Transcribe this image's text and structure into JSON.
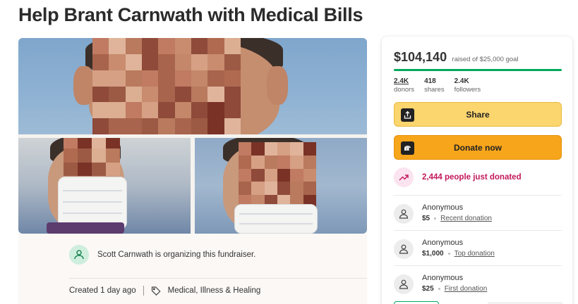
{
  "campaign": {
    "title": "Help Brant Carnwath with Medical Bills",
    "organizer_text": "Scott Carnwath is organizing this fundraiser.",
    "created": "Created 1 day ago",
    "category": "Medical, Illness & Healing"
  },
  "donate_card": {
    "raised_amount": "$104,140",
    "raised_goal": "raised of $25,000 goal",
    "progress_percent": 100,
    "stats": [
      {
        "value": "2.4K",
        "label": "donors"
      },
      {
        "value": "418",
        "label": "shares"
      },
      {
        "value": "2.4K",
        "label": "followers"
      }
    ],
    "share_label": "Share",
    "donate_label": "Donate now",
    "trend_text": "2,444 people just donated",
    "donations": [
      {
        "name": "Anonymous",
        "amount": "$5",
        "tag": "Recent donation"
      },
      {
        "name": "Anonymous",
        "amount": "$1,000",
        "tag": "Top donation"
      },
      {
        "name": "Anonymous",
        "amount": "$25",
        "tag": "First donation"
      }
    ]
  },
  "colors": {
    "brand_green": "#02a95c",
    "share_yellow": "#fbd56e",
    "donate_orange": "#f7a51b",
    "trend_pink": "#c2185b"
  },
  "icons": {
    "share": "share-upload-icon",
    "donate": "gofundme-logo-icon",
    "trend": "trending-up-icon",
    "avatar": "person-icon",
    "tag": "tag-icon"
  }
}
